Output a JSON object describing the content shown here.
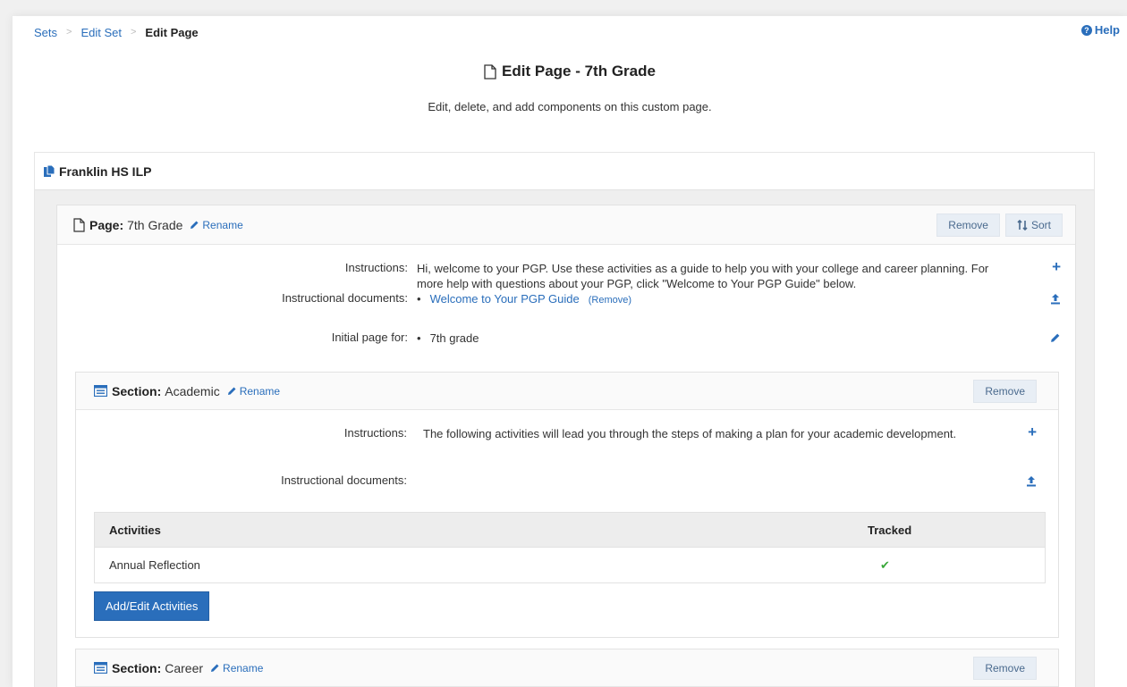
{
  "breadcrumb": {
    "items": [
      "Sets",
      "Edit Set",
      "Edit Page"
    ],
    "separator": ">"
  },
  "help_label": "Help",
  "title": "Edit Page - 7th Grade",
  "subtitle": "Edit, delete, and add components on this custom page.",
  "set_name": "Franklin HS ILP",
  "page_panel": {
    "label": "Page:",
    "name": "7th Grade",
    "rename": "Rename",
    "remove": "Remove",
    "sort": "Sort",
    "instructions_label": "Instructions:",
    "instructions_text": "Hi, welcome to your PGP. Use these activities as a guide to help you with your college and career planning. For more help with questions about your PGP, click \"Welcome to Your PGP Guide\" below.",
    "docs_label": "Instructional documents:",
    "doc_link": "Welcome to Your PGP Guide",
    "doc_remove": "(Remove)",
    "initial_label": "Initial page for:",
    "initial_value": "7th grade"
  },
  "section_academic": {
    "label": "Section:",
    "name": "Academic",
    "rename": "Rename",
    "remove": "Remove",
    "instructions_label": "Instructions:",
    "instructions_text": "The following activities will lead you through the steps of making a plan for your academic development.",
    "docs_label": "Instructional documents:",
    "table": {
      "col_activities": "Activities",
      "col_tracked": "Tracked",
      "rows": [
        {
          "activity": "Annual Reflection",
          "tracked": "✔"
        }
      ]
    },
    "add_edit_button": "Add/Edit Activities"
  },
  "section_career": {
    "label": "Section:",
    "name": "Career",
    "rename": "Rename",
    "remove": "Remove"
  },
  "colors": {
    "accent": "#2a6ebb",
    "check": "#3aa83a",
    "light_button": "#e8eef5"
  }
}
